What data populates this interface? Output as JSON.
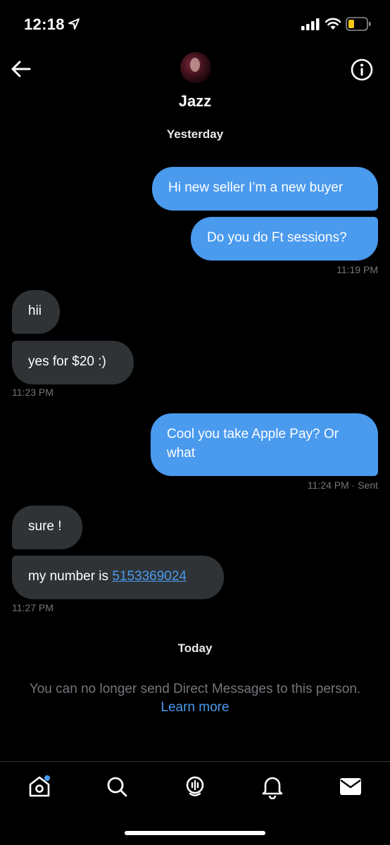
{
  "status_bar": {
    "time": "12:18"
  },
  "header": {
    "contact_name": "Jazz"
  },
  "dividers": {
    "yesterday": "Yesterday",
    "today": "Today"
  },
  "messages": [
    {
      "dir": "out",
      "text": "Hi new seller I’m a new buyer"
    },
    {
      "dir": "out",
      "text": "Do you do Ft sessions?"
    },
    {
      "dir": "meta",
      "text": "11:19 PM"
    },
    {
      "dir": "in",
      "text": "hii"
    },
    {
      "dir": "in",
      "text": "yes for $20 :)"
    },
    {
      "dir": "meta",
      "text": "11:23 PM"
    },
    {
      "dir": "out",
      "text": "Cool you take Apple Pay? Or what"
    },
    {
      "dir": "meta",
      "text": "11:24 PM",
      "status": "· Sent"
    },
    {
      "dir": "in",
      "text": "sure !"
    },
    {
      "dir": "in",
      "text": "my number is",
      "link": "5153369024"
    },
    {
      "dir": "meta",
      "text": "11:27 PM"
    }
  ],
  "notice": {
    "text": "You can no longer send Direct Messages to this person.",
    "link": "Learn more"
  },
  "nav": {
    "items": [
      "home-icon",
      "search-icon",
      "spaces-icon",
      "notifications-icon",
      "messages-icon"
    ],
    "home_has_badge": true
  },
  "colors": {
    "accent": "#4a9aee",
    "incoming_bubble": "#2f3336",
    "muted": "#71767b",
    "background": "#000000"
  }
}
